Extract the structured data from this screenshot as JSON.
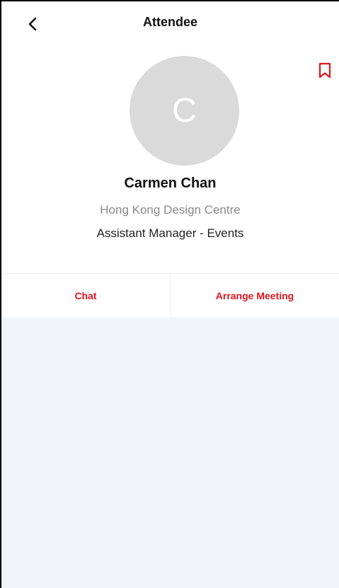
{
  "header": {
    "title": "Attendee",
    "back_icon": "chevron-left-icon"
  },
  "bookmark": {
    "icon": "bookmark-icon",
    "color": "#e0141e"
  },
  "profile": {
    "avatar_initial": "C",
    "name": "Carmen Chan",
    "company": "Hong Kong Design Centre",
    "role": "Assistant Manager - Events"
  },
  "actions": {
    "chat_label": "Chat",
    "meeting_label": "Arrange Meeting"
  },
  "colors": {
    "accent": "#e0141e",
    "avatar_bg": "#dadada",
    "content_bg": "#f2f3f7"
  }
}
